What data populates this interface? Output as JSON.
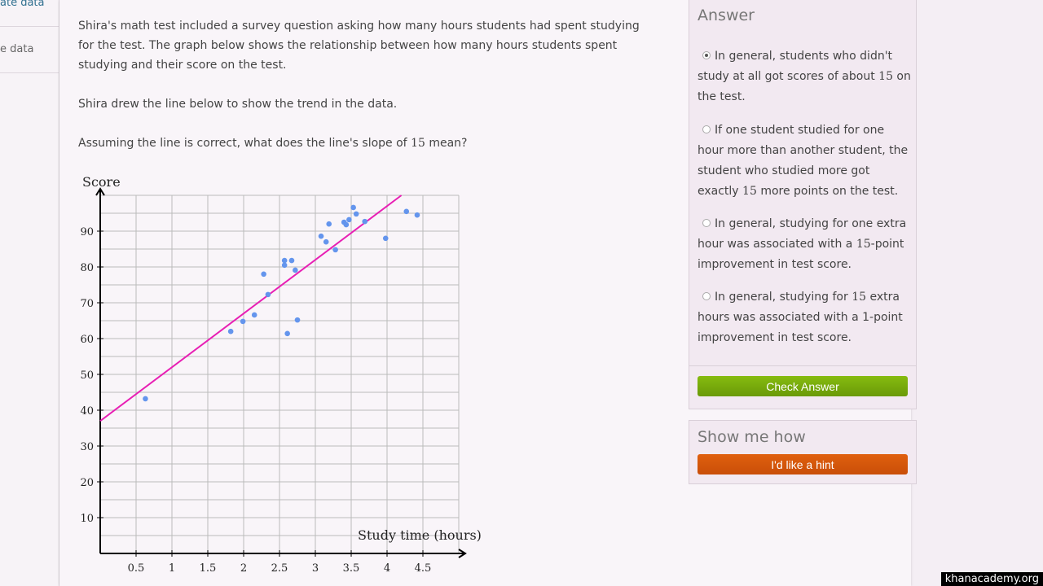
{
  "sidebar": {
    "items": [
      {
        "label": "ate data"
      },
      {
        "label": "e data"
      }
    ]
  },
  "question": {
    "para1": "Shira's math test included a survey question asking how many hours students had spent studying for the test. The graph below shows the relationship between how many hours students spent studying and their score on the test.",
    "para2": "Shira drew the line below to show the trend in the data.",
    "para3_a": "Assuming the line is correct, what does the line's slope of ",
    "para3_num": "15",
    "para3_b": " mean?"
  },
  "chart_data": {
    "type": "scatter",
    "xlabel": "Study time (hours)",
    "ylabel": "Score",
    "xlim": [
      0,
      5
    ],
    "ylim": [
      0,
      100
    ],
    "x_ticks": [
      "0.5",
      "1",
      "1.5",
      "2",
      "2.5",
      "3",
      "3.5",
      "4",
      "4.5"
    ],
    "y_ticks": [
      "10",
      "20",
      "30",
      "40",
      "50",
      "60",
      "70",
      "80",
      "90"
    ],
    "grid": true,
    "point_color": "#6495ed",
    "line_color": "#e81fb4",
    "trend_line": {
      "intercept": 37,
      "slope": 15,
      "x_range": [
        0,
        4.2
      ]
    },
    "points": [
      [
        0.63,
        43.2
      ],
      [
        1.82,
        62
      ],
      [
        1.99,
        64.8
      ],
      [
        2.15,
        66.6
      ],
      [
        2.28,
        78
      ],
      [
        2.34,
        72.3
      ],
      [
        2.57,
        81.8
      ],
      [
        2.57,
        80.5
      ],
      [
        2.67,
        81.8
      ],
      [
        2.72,
        79.1
      ],
      [
        2.61,
        61.4
      ],
      [
        2.75,
        65.2
      ],
      [
        3.08,
        88.6
      ],
      [
        3.15,
        87
      ],
      [
        3.19,
        92
      ],
      [
        3.28,
        84.8
      ],
      [
        3.4,
        92.5
      ],
      [
        3.43,
        91.8
      ],
      [
        3.47,
        93.2
      ],
      [
        3.53,
        96.6
      ],
      [
        3.57,
        94.8
      ],
      [
        3.69,
        92.7
      ],
      [
        3.98,
        88
      ],
      [
        4.27,
        95.5
      ],
      [
        4.42,
        94.5
      ]
    ]
  },
  "answer": {
    "title": "Answer",
    "options": [
      {
        "a": "In general, students who didn't study at all got scores of about ",
        "num": "15",
        "b": " on the test.",
        "selected": true
      },
      {
        "a": "If one student studied for one hour more than another student, the student who studied more got exactly ",
        "num": "15",
        "b": " more points on the test.",
        "selected": false
      },
      {
        "a": "In general, studying for one extra hour was associated with a ",
        "num": "15",
        "b": "-point improvement in test score.",
        "selected": false
      },
      {
        "a": "In general, studying for ",
        "num": "15",
        "b": " extra hours was associated with a 1-point improvement in test score.",
        "selected": false
      }
    ],
    "check_label": "Check Answer",
    "check_color": "#76a80a"
  },
  "hint": {
    "title": "Show me how",
    "button_label": "I'd like a hint",
    "button_color": "#d9560b"
  },
  "watermark": "khanacademy.org"
}
